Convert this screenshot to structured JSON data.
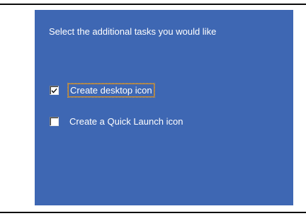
{
  "colors": {
    "panel_background": "#3e67b3",
    "text": "#ffffff",
    "focus_border": "#c98a2e"
  },
  "wizard": {
    "instruction": "Select the additional tasks you would like"
  },
  "tasks": [
    {
      "label": "Create desktop icon",
      "checked": true,
      "focused": true,
      "icon": "checkmark-icon"
    },
    {
      "label": "Create a Quick Launch icon",
      "checked": false,
      "focused": false
    }
  ]
}
